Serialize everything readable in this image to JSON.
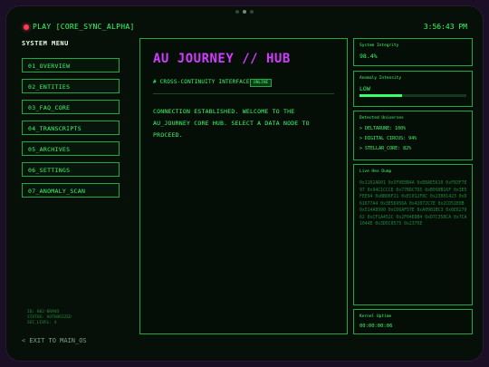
{
  "topbar": {
    "play_label": "PLAY [CORE_SYNC_ALPHA]",
    "clock": "3:56:43 PM"
  },
  "sidebar": {
    "title": "SYSTEM MENU",
    "items": [
      {
        "label": "01_OVERVIEW"
      },
      {
        "label": "02_ENTITIES"
      },
      {
        "label": "03_FAQ_CORE"
      },
      {
        "label": "04_TRANSCRIPTS"
      },
      {
        "label": "05_ARCHIVES"
      },
      {
        "label": "06_SETTINGS"
      },
      {
        "label": "07_ANOMALY_SCAN"
      }
    ],
    "sys_info": [
      "ID: 882-BRAVO",
      "STATUS: AUTHORIZED",
      "SEC_LEVEL: 4"
    ],
    "exit_label": "< EXIT TO MAIN_OS"
  },
  "main": {
    "title": "AU JOURNEY // HUB",
    "subtitle": "# CROSS-CONTINUITY INTERFACE",
    "badge": "ONLINE",
    "message": "CONNECTION ESTABLISHED. WELCOME TO THE AU_JOURNEY CORE HUB. SELECT A DATA NODE TO PROCEED."
  },
  "right": {
    "integrity": {
      "label": "System Integrity",
      "value": "98.4%"
    },
    "anomaly": {
      "label": "Anomaly Intensity",
      "value": "LOW",
      "fill_percent": 40
    },
    "universes": {
      "label": "Detected Universes",
      "items": [
        "> DELTARUNE: 100%",
        "> DIGITAL CIRCUS: 94%",
        "> STELLAR_CORE: 82%"
      ]
    },
    "hex": {
      "label": "Live Hex Dump",
      "text": "0x1102AD01 0x5F0E8B4A 0xB8AE5610 0xF83F7E97 0x94C1CCCE 0x77BDC7D5 0xB090B16F 0x3E5FEE94 0xBB06F21 0xEC012F8C 0x23001423 0xD61677A4 0x3E56956A 0x42072C7E 0x2CD51E0B 0x514A8990 0xCD6AF57E 0xA0981BC3 0x6E627062 0xCF1A452C 0x2F04E8B4 0xD7C358CA 0x7CA1044E 0x3D5C0575 0x2375E"
    },
    "uptime": {
      "label": "Kernel Uptime",
      "value": "00:00:00:06"
    }
  }
}
